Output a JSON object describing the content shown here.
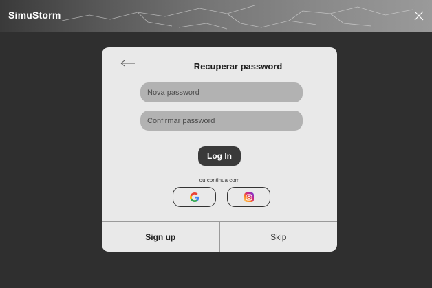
{
  "window": {
    "app_title": "SimuStorm",
    "close_icon": "close-icon"
  },
  "dialog": {
    "title": "Recuperar password",
    "back_icon": "arrow-left-icon",
    "new_password_placeholder": "Nova password",
    "confirm_password_placeholder": "Confirmar password",
    "login_label": "Log In",
    "divider_text": "ou continua com",
    "social": [
      {
        "name": "google",
        "icon": "google-icon"
      },
      {
        "name": "instagram",
        "icon": "instagram-icon"
      }
    ],
    "signup_label": "Sign up",
    "skip_label": "Skip"
  },
  "colors": {
    "background": "#2f2f2f",
    "card": "#e9e9e9",
    "input": "#b2b2b2",
    "button": "#3a3a3a"
  }
}
